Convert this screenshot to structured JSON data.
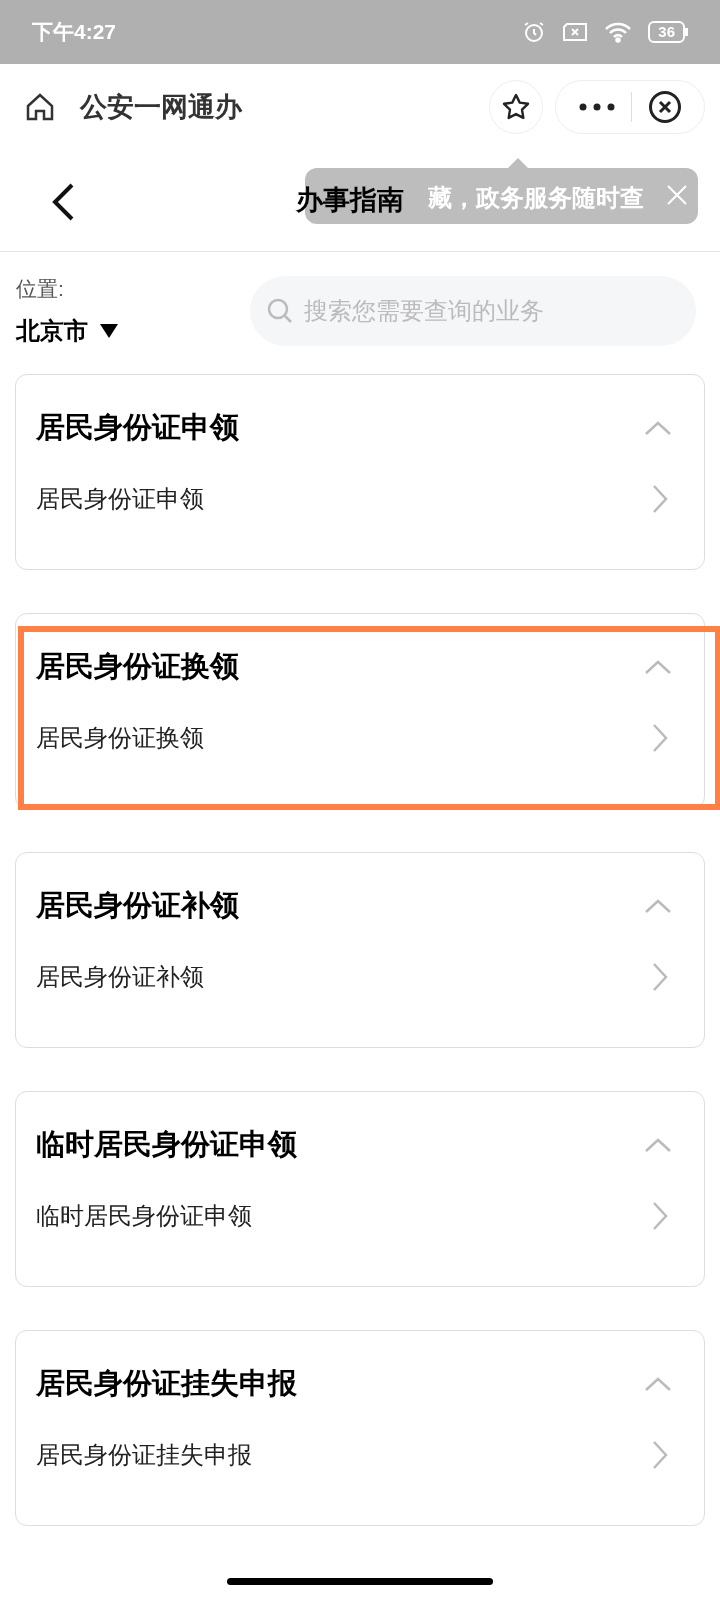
{
  "status_bar": {
    "time": "下午4:27",
    "battery": "36"
  },
  "mini_program_bar": {
    "title": "公安一网通办"
  },
  "tooltip": {
    "text": "藏，政务服务随时查"
  },
  "page_header": {
    "title": "办事指南"
  },
  "location": {
    "label": "位置:",
    "value": "北京市"
  },
  "search": {
    "placeholder": "搜索您需要查询的业务"
  },
  "sections": [
    {
      "title": "居民身份证申领",
      "expanded": true,
      "highlighted": false,
      "items": [
        "居民身份证申领"
      ]
    },
    {
      "title": "居民身份证换领",
      "expanded": true,
      "highlighted": true,
      "items": [
        "居民身份证换领"
      ]
    },
    {
      "title": "居民身份证补领",
      "expanded": true,
      "highlighted": false,
      "items": [
        "居民身份证补领"
      ]
    },
    {
      "title": "临时居民身份证申领",
      "expanded": true,
      "highlighted": false,
      "items": [
        "临时居民身份证申领"
      ]
    },
    {
      "title": "居民身份证挂失申报",
      "expanded": true,
      "highlighted": false,
      "items": [
        "居民身份证挂失申报"
      ]
    }
  ]
}
